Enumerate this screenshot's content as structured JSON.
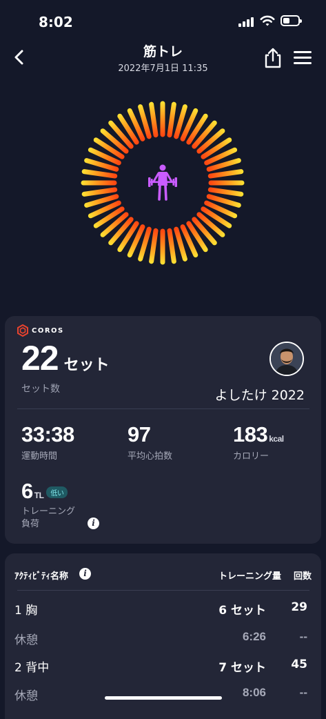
{
  "status_bar": {
    "time": "8:02"
  },
  "header": {
    "title": "筋トレ",
    "datetime": "2022年7月1日 11:35"
  },
  "summary": {
    "brand": "COROS",
    "sets_value": "22",
    "sets_unit": "セット",
    "sets_label": "セット数",
    "username": "よしたけ 2022",
    "metrics": [
      {
        "value": "33:38",
        "unit": "",
        "label": "運動時間"
      },
      {
        "value": "97",
        "unit": "",
        "label": "平均心拍数"
      },
      {
        "value": "183",
        "unit": "kcal",
        "label": "カロリー"
      }
    ],
    "training_load": {
      "value": "6",
      "unit": "TL",
      "badge": "低い",
      "label_line1": "トレーニング",
      "label_line2": "負荷"
    }
  },
  "activity_table": {
    "headers": {
      "name": "ｱｸﾃｨﾋﾞﾃｨ名称",
      "amount": "トレーニング量",
      "count": "回数"
    },
    "rows": [
      {
        "name": "1 胸",
        "amount": "6 セット",
        "count": "29"
      },
      {
        "name": "休憩",
        "amount": "6:26",
        "count": "--"
      },
      {
        "name": "2 背中",
        "amount": "7 セット",
        "count": "45"
      },
      {
        "name": "休憩",
        "amount": "8:06",
        "count": "--"
      }
    ]
  },
  "colors": {
    "background": "#141829",
    "card": "#232637",
    "ring_inner": "#ff4a12",
    "ring_outer": "#ffe033",
    "activity_icon": "#c95cff"
  },
  "icons": [
    "back-chevron-icon",
    "share-icon",
    "menu-icon",
    "weightlifting-icon",
    "coros-logo-icon",
    "info-icon"
  ]
}
